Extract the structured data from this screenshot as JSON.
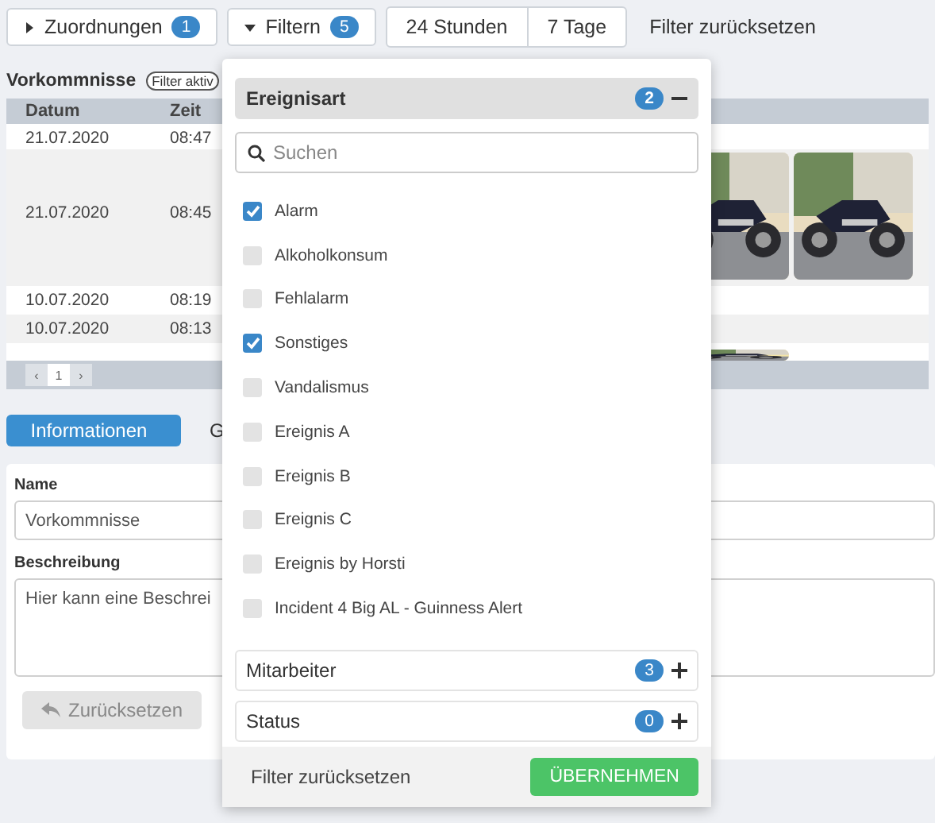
{
  "toolbar": {
    "toggles": [
      {
        "label": "Zuordnungen",
        "count": "1",
        "expanded": false
      },
      {
        "label": "Filtern",
        "count": "5",
        "expanded": true
      }
    ],
    "ranges": [
      {
        "label": "24 Stunden"
      },
      {
        "label": "7 Tage"
      }
    ],
    "reset_link": "Filter zurücksetzen"
  },
  "list": {
    "title": "Vorkommnisse",
    "filter_badge": "Filter aktiv",
    "columns": [
      "Datum",
      "Zeit"
    ],
    "rows": [
      {
        "date": "21.07.2020",
        "time": "08:47"
      },
      {
        "date": "21.07.2020",
        "time": "08:45",
        "images": [
          {
            "kind": "picture"
          },
          {
            "kind": "picture"
          }
        ]
      },
      {
        "date": "10.07.2020",
        "time": "08:19"
      },
      {
        "date": "10.07.2020",
        "time": "08:13"
      },
      {
        "images": [
          {
            "kind": "picture"
          }
        ]
      }
    ],
    "pagination": {
      "prev": "‹",
      "page": "1",
      "next": "›"
    }
  },
  "tabs": [
    {
      "label": "Informationen",
      "selected": true
    },
    {
      "label": "G",
      "selected": false
    }
  ],
  "form": {
    "fields": [
      {
        "kind": "input",
        "label": "Name",
        "value": "Vorkommnisse"
      },
      {
        "kind": "textarea",
        "label": "Beschreibung",
        "value": "Hier kann eine Beschrei"
      }
    ],
    "reset_button": {
      "label": "Zurücksetzen",
      "disabled": true
    }
  },
  "filter_dropdown": {
    "sections": [
      {
        "title": "Ereignisart",
        "count": "2",
        "expanded": true,
        "search_placeholder": "Suchen",
        "options": [
          {
            "label": "Alarm",
            "checked": true
          },
          {
            "label": "Alkoholkonsum",
            "checked": false
          },
          {
            "label": "Fehlalarm",
            "checked": false
          },
          {
            "label": "Sonstiges",
            "checked": true
          },
          {
            "label": "Vandalismus",
            "checked": false
          },
          {
            "label": "Ereignis A",
            "checked": false
          },
          {
            "label": "Ereignis B",
            "checked": false
          },
          {
            "label": "Ereignis C",
            "checked": false
          },
          {
            "label": "Ereignis by Horsti",
            "checked": false
          },
          {
            "label": "Incident 4 Big AL - Guinness Alert",
            "checked": false
          }
        ]
      },
      {
        "title": "Mitarbeiter",
        "count": "3",
        "expanded": false
      },
      {
        "title": "Status",
        "count": "0",
        "expanded": false
      }
    ],
    "reset_label": "Filter zurücksetzen",
    "apply_label": "ÜBERNEHMEN"
  }
}
